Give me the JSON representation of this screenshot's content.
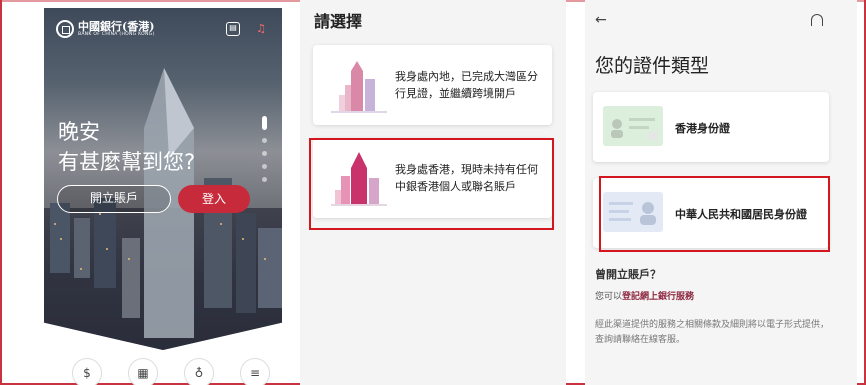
{
  "home": {
    "brand_name": "中國銀行(香港)",
    "brand_sub": "BANK OF CHINA (HONG KONG)",
    "greeting_line1": "晚安",
    "greeting_line2": "有甚麼幫到您?",
    "open_account_label": "開立賬戶",
    "login_label": "登入",
    "bottom_icons": [
      "dollar-icon",
      "calendar-icon",
      "headset-icon",
      "menu-icon"
    ],
    "accent_color": "#c72b3b"
  },
  "select": {
    "title": "請選擇",
    "options": [
      {
        "text": "我身處內地，已完成大灣區分行見證，並繼續跨境開戶"
      },
      {
        "text": "我身處香港，現時未持有任何中銀香港個人或聯名賬戶"
      }
    ]
  },
  "doc_type": {
    "title": "您的證件類型",
    "cards": [
      {
        "label": "香港身份證"
      },
      {
        "label": "中華人民共和國居民身份證"
      }
    ],
    "question": "曾開立賬戶？",
    "register_prefix": "您可以",
    "register_link": "登記網上銀行服務",
    "note": "經此渠道提供的服務之相關條款及細則將以電子形式提供，查詢請聯絡在線客服。"
  },
  "highlight_color": "#d4161f"
}
